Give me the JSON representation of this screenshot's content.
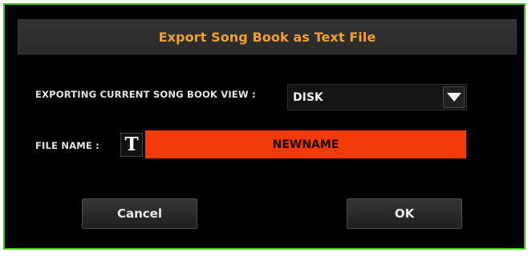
{
  "dialog": {
    "title": "Export Song Book  as Text File",
    "view_label": "EXPORTING CURRENT SONG BOOK VIEW :",
    "view_value": "DISK",
    "file_label": "FILE NAME :",
    "text_edit_icon": "T",
    "file_name_value": "NEWNAME",
    "cancel_label": "Cancel",
    "ok_label": "OK"
  },
  "colors": {
    "frame_border": "#43c31a",
    "title_text": "#f0a030",
    "filename_field": "#f23a0a"
  }
}
